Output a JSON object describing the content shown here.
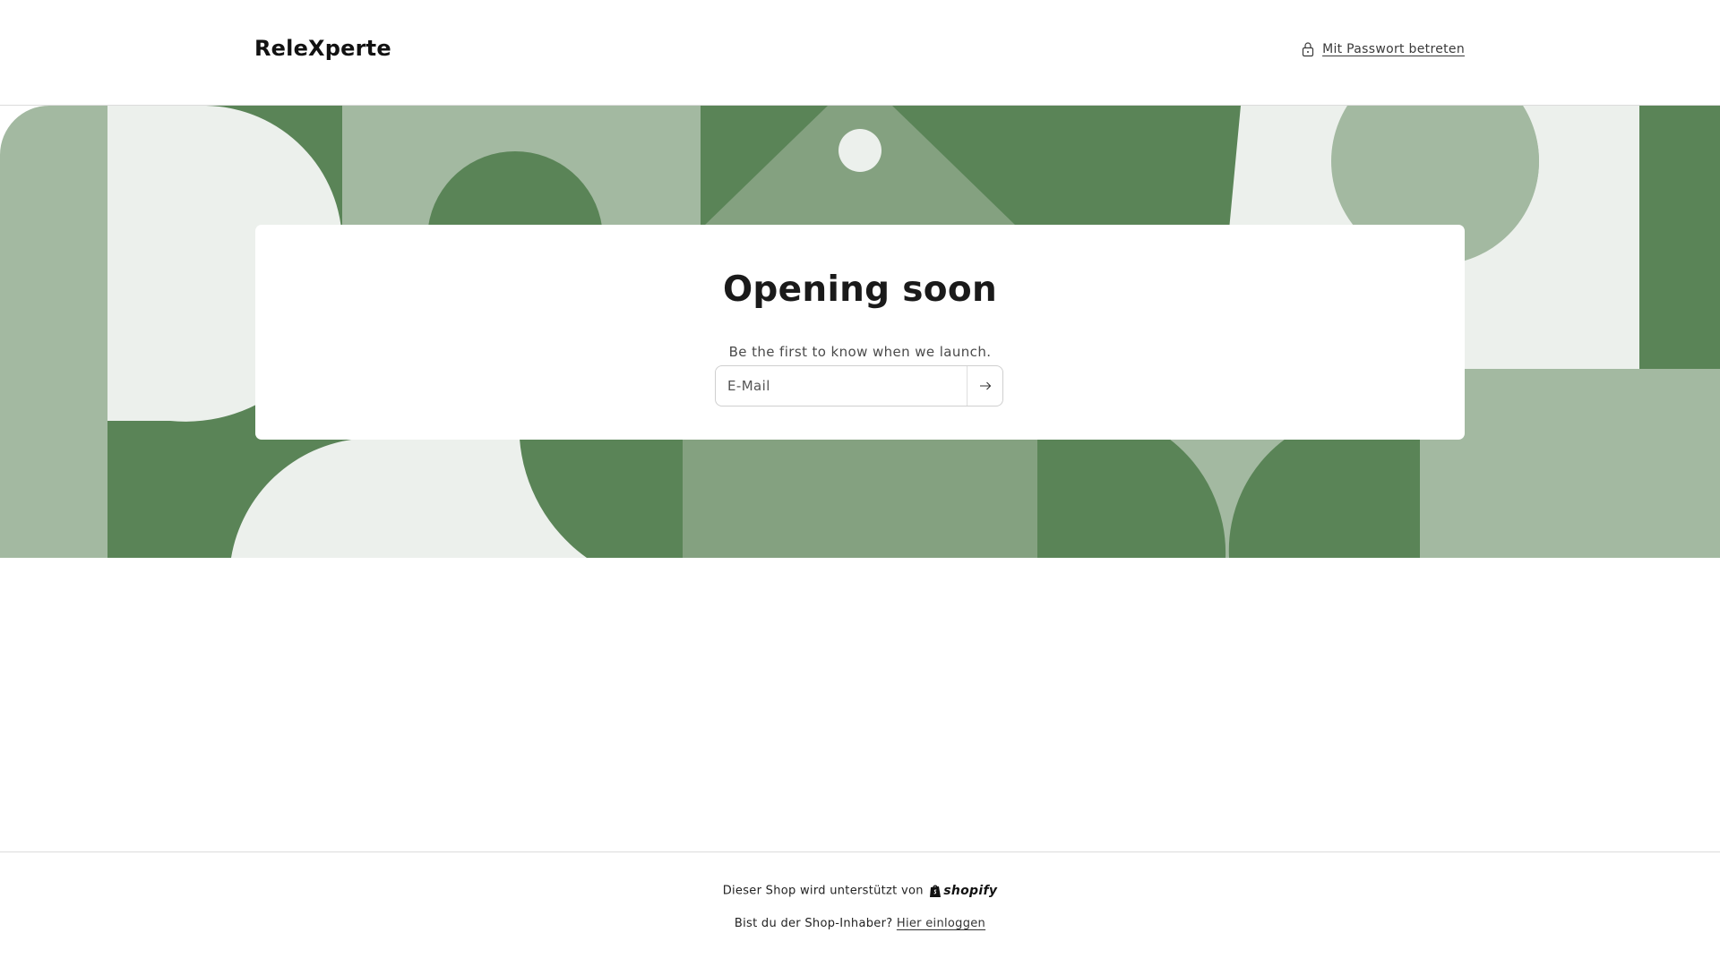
{
  "header": {
    "brand": "ReleXperte",
    "password_link": "Mit Passwort betreten",
    "password_icon": "lock-icon"
  },
  "colors": {
    "dark_green": "#5a8457",
    "mid_green": "#84a180",
    "light_green": "#a3b9a1",
    "pale_green": "#ecf0ec",
    "text": "#121212"
  },
  "card": {
    "title": "Opening soon",
    "subtitle": "Be the first to know when we launch.",
    "email_placeholder": "E-Mail",
    "submit_icon": "arrow-right-icon"
  },
  "footer": {
    "powered_text": "Dieser Shop wird unterstützt von",
    "shopify_logo": "shopify",
    "owner_text": "Bist du der Shop-Inhaber?",
    "login_link": "Hier einloggen"
  }
}
